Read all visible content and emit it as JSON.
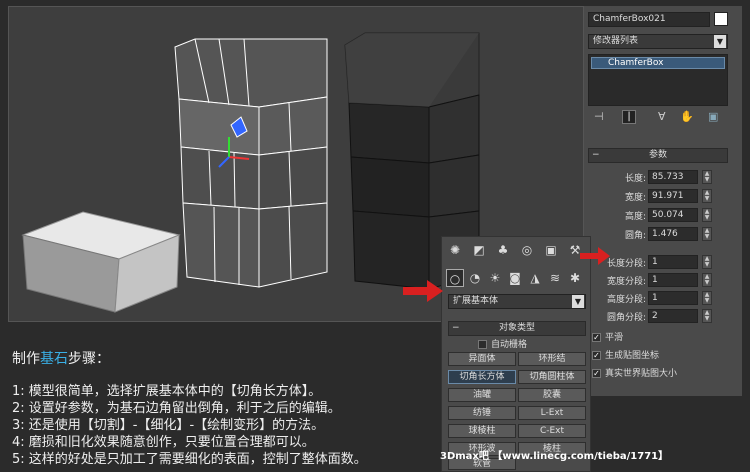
{
  "modify_panel": {
    "object_name": "ChamferBox021",
    "modifier_list": "修改器列表",
    "stack_item": "ChamferBox",
    "params_title": "参数",
    "params": [
      {
        "label": "长度:",
        "value": "85.733"
      },
      {
        "label": "宽度:",
        "value": "91.971"
      },
      {
        "label": "高度:",
        "value": "50.074"
      },
      {
        "label": "圆角:",
        "value": "1.476"
      },
      {
        "label": "长度分段:",
        "value": "1"
      },
      {
        "label": "宽度分段:",
        "value": "1"
      },
      {
        "label": "高度分段:",
        "value": "1"
      },
      {
        "label": "圆角分段:",
        "value": "2"
      }
    ],
    "smooth_label": "平滑",
    "gen_mapping_label": "生成贴图坐标",
    "real_world_label": "真实世界贴图大小"
  },
  "create_panel": {
    "category_select": "扩展基本体",
    "object_type_title": "对象类型",
    "autogrid_label": "自动栅格",
    "buttons": [
      "异面体",
      "环形结",
      "切角长方体",
      "切角圆柱体",
      "油罐",
      "胶囊",
      "纺锤",
      "L-Ext",
      "球棱柱",
      "C-Ext",
      "环形波",
      "棱柱",
      "软管"
    ]
  },
  "tutorial": {
    "title_prefix": "制作",
    "title_highlight": "基石",
    "title_suffix": "步骤：",
    "steps": [
      "1: 模型很简单，选择扩展基本体中的【切角长方体】。",
      "2: 设置好参数，为基石边角留出倒角，利于之后的编辑。",
      "3: 还是使用【切割】-【细化】-【绘制变形】的方法。",
      "4: 磨损和旧化效果随意创作，只要位置合理都可以。",
      "5: 这样的好处是只加工了需要细化的表面，控制了整体面数。"
    ]
  },
  "watermark": "3Dmax吧  【www.linecg.com/tieba/1771】",
  "colors": {
    "highlight_text": "#3ab0e6",
    "arrow_red": "#d92020",
    "panel_bg": "#4a4a4a",
    "viewport_bg": "#3e3e3e"
  }
}
